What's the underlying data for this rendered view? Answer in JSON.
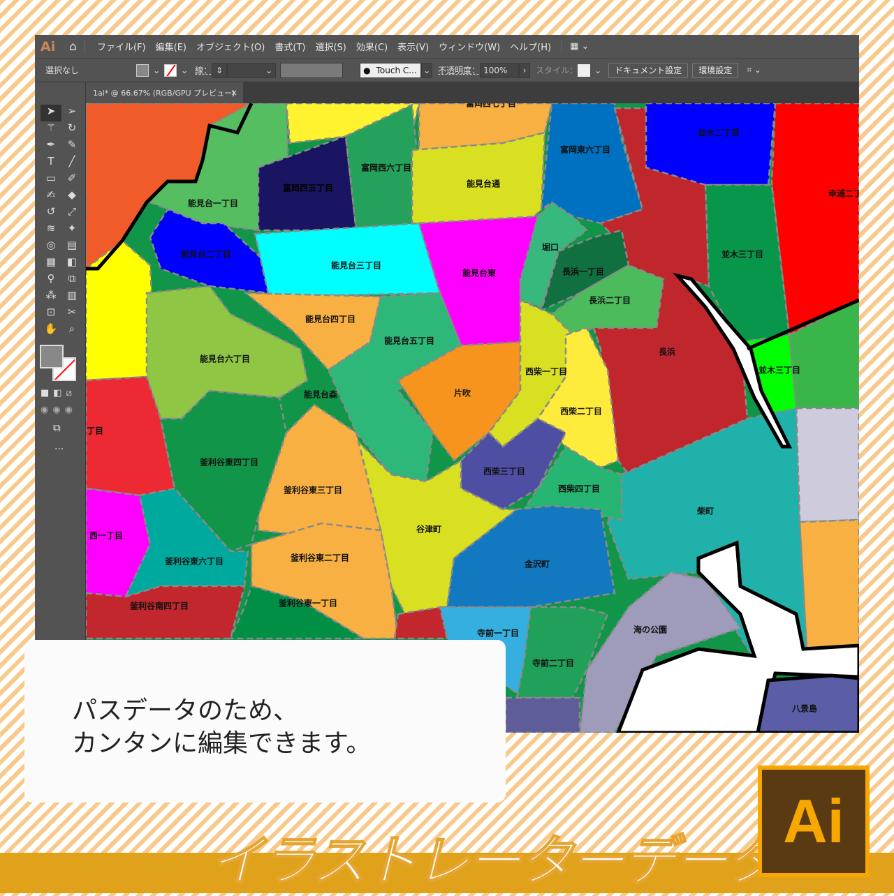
{
  "app": {
    "logo": "Ai",
    "home_icon": "home-icon"
  },
  "menu": [
    "ファイル(F)",
    "編集(E)",
    "オブジェクト(O)",
    "書式(T)",
    "選択(S)",
    "効果(C)",
    "表示(V)",
    "ウィンドウ(W)",
    "ヘルプ(H)"
  ],
  "control": {
    "selection": "選択なし",
    "stroke_label": "線：",
    "brush": "Touch C...",
    "opacity_label": "不透明度：",
    "opacity": "100%",
    "style_label": "スタイル：",
    "doc_settings": "ドキュメント設定",
    "preferences": "環境設定"
  },
  "tab": {
    "title": "1ai* @ 66.67% (RGB/GPU プレビュー)",
    "close": "×"
  },
  "toolbar": {
    "more": "..."
  },
  "map": {
    "labels": [
      "富岡西七丁目",
      "能見台一丁目",
      "富岡西五丁目",
      "富岡西六丁目",
      "能見台通",
      "富岡東六丁目",
      "並木二丁目",
      "幸浦二丁",
      "能見台二丁目",
      "能見台三丁目",
      "能見台東",
      "堀口",
      "長浜一丁目",
      "並木三丁目",
      "長浜二丁目",
      "能見台四丁目",
      "能見台五丁目",
      "長浜",
      "能見台六丁目",
      "西柴一丁目",
      "並木三丁目",
      "片吹",
      "能見台森",
      "西柴二丁目",
      "丁目",
      "釜利谷東四丁目",
      "西柴三丁目",
      "釜利谷東三丁目",
      "西柴四丁目",
      "柴町",
      "谷津町",
      "西一丁目",
      "釜利谷東六丁目",
      "金沢町",
      "釜利谷東二丁目",
      "釜利谷東一丁目",
      "釜利谷南四丁目",
      "海の公園",
      "寺前一丁目",
      "寺前二丁目",
      "八景島"
    ]
  },
  "card": {
    "line1": "パスデータのため、",
    "line2": "カンタンに編集できます。"
  },
  "banner": {
    "title": "イラストレーターデータ",
    "logo": "Ai"
  },
  "colors": {
    "band": "#e0a21b",
    "logo_border": "#f7a800",
    "logo_bg": "#5a3a12"
  }
}
